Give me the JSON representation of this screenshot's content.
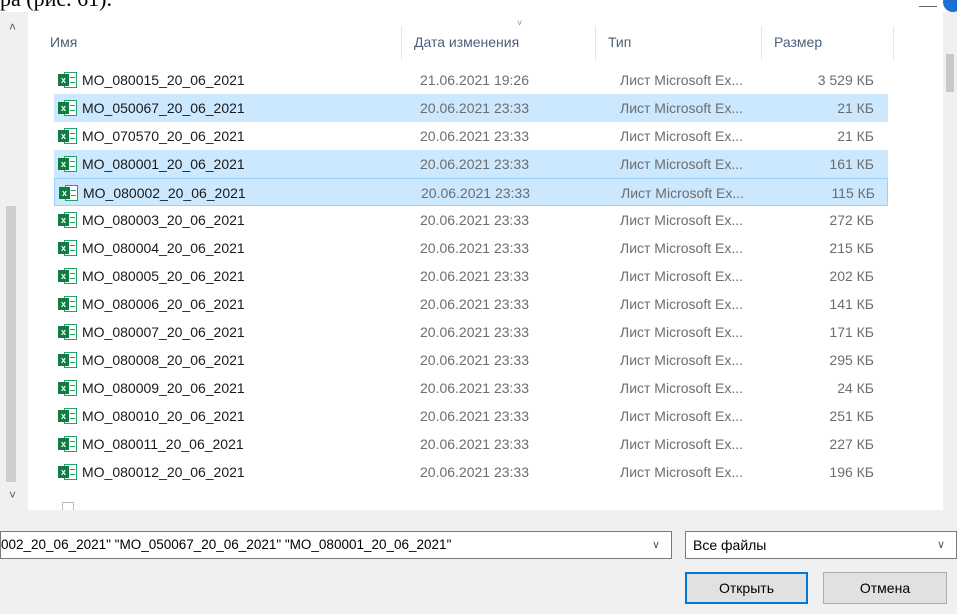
{
  "caption": "ра (рис. 61).",
  "columns": {
    "name": "Имя",
    "date": "Дата изменения",
    "type": "Тип",
    "size": "Размер"
  },
  "files": [
    {
      "name": "MO_080015_20_06_2021",
      "date": "21.06.2021 19:26",
      "type": "Лист Microsoft Ex...",
      "size": "3 529 КБ",
      "state": "normal"
    },
    {
      "name": "MO_050067_20_06_2021",
      "date": "20.06.2021 23:33",
      "type": "Лист Microsoft Ex...",
      "size": "21 КБ",
      "state": "selected"
    },
    {
      "name": "MO_070570_20_06_2021",
      "date": "20.06.2021 23:33",
      "type": "Лист Microsoft Ex...",
      "size": "21 КБ",
      "state": "normal"
    },
    {
      "name": "MO_080001_20_06_2021",
      "date": "20.06.2021 23:33",
      "type": "Лист Microsoft Ex...",
      "size": "161 КБ",
      "state": "selected"
    },
    {
      "name": "MO_080002_20_06_2021",
      "date": "20.06.2021 23:33",
      "type": "Лист Microsoft Ex...",
      "size": "115 КБ",
      "state": "focused"
    },
    {
      "name": "MO_080003_20_06_2021",
      "date": "20.06.2021 23:33",
      "type": "Лист Microsoft Ex...",
      "size": "272 КБ",
      "state": "normal"
    },
    {
      "name": "MO_080004_20_06_2021",
      "date": "20.06.2021 23:33",
      "type": "Лист Microsoft Ex...",
      "size": "215 КБ",
      "state": "normal"
    },
    {
      "name": "MO_080005_20_06_2021",
      "date": "20.06.2021 23:33",
      "type": "Лист Microsoft Ex...",
      "size": "202 КБ",
      "state": "normal"
    },
    {
      "name": "MO_080006_20_06_2021",
      "date": "20.06.2021 23:33",
      "type": "Лист Microsoft Ex...",
      "size": "141 КБ",
      "state": "normal"
    },
    {
      "name": "MO_080007_20_06_2021",
      "date": "20.06.2021 23:33",
      "type": "Лист Microsoft Ex...",
      "size": "171 КБ",
      "state": "normal"
    },
    {
      "name": "MO_080008_20_06_2021",
      "date": "20.06.2021 23:33",
      "type": "Лист Microsoft Ex...",
      "size": "295 КБ",
      "state": "normal"
    },
    {
      "name": "MO_080009_20_06_2021",
      "date": "20.06.2021 23:33",
      "type": "Лист Microsoft Ex...",
      "size": "24 КБ",
      "state": "normal"
    },
    {
      "name": "MO_080010_20_06_2021",
      "date": "20.06.2021 23:33",
      "type": "Лист Microsoft Ex...",
      "size": "251 КБ",
      "state": "normal"
    },
    {
      "name": "MO_080011_20_06_2021",
      "date": "20.06.2021 23:33",
      "type": "Лист Microsoft Ex...",
      "size": "227 КБ",
      "state": "normal"
    },
    {
      "name": "MO_080012_20_06_2021",
      "date": "20.06.2021 23:33",
      "type": "Лист Microsoft Ex...",
      "size": "196 КБ",
      "state": "normal"
    }
  ],
  "file_icon": "excel-file-icon",
  "filename_field": {
    "value": "002_20_06_2021\" \"MO_050067_20_06_2021\" \"MO_080001_20_06_2021\""
  },
  "file_type_filter": {
    "selected": "Все файлы"
  },
  "buttons": {
    "open": "Открыть",
    "cancel": "Отмена"
  },
  "colors": {
    "selection": "#cce8ff",
    "focus_border": "#99d1ff",
    "default_button_border": "#0078d7",
    "excel_green": "#107c41"
  }
}
